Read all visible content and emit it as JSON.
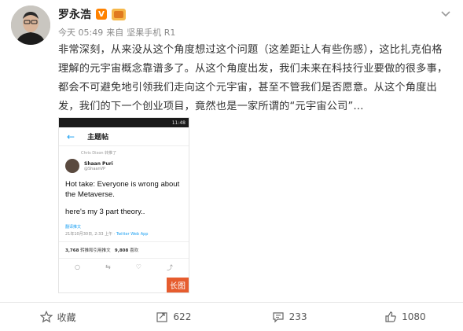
{
  "post": {
    "author": "罗永浩",
    "verified_mark": "V",
    "time": "今天 05:49",
    "source_prefix": "来自",
    "source": "坚果手机 R1",
    "text": "非常深刻，从来没从这个角度想过这个问题（这差距让人有些伤感），这比扎克伯格理解的元宇宙概念靠谱多了。从这个角度出发，我们未来在科技行业要做的很多事，都会不可避免地引领我们走向这个元宇宙，甚至不管我们是否愿意。从这个角度出发，我们的下一个创业项目，竟然也是一家所谓的“元宇宙公司”..."
  },
  "embedded_image": {
    "time": "11:48",
    "title": "主题帖",
    "retweet_line": "Chris Dixon 转推了",
    "user_name": "Shaan Puri",
    "user_handle": "@ShaanVP",
    "body_1": "Hot take: Everyone is wrong about the Metaverse.",
    "body_2": "here's my 3 part theory..",
    "translate": "翻译推文",
    "date_line": "21年10月30日, 2:33 上午 ·",
    "client": "Twitter Web App",
    "retweets_count": "3,768",
    "retweets_label": "转推和引用推文",
    "likes_count": "9,808",
    "likes_label": "喜欢",
    "long_image_tag": "长图"
  },
  "actions": {
    "favorite": "收藏",
    "repost": "622",
    "comment": "233",
    "like": "1080"
  },
  "colors": {
    "accent": "#ff8200",
    "twitter_blue": "#1da1f2",
    "long_image_tag": "#e65c2e"
  }
}
